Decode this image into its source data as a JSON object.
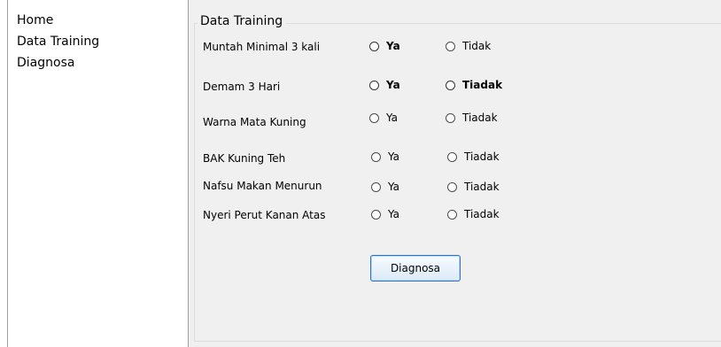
{
  "sidebar": {
    "items": [
      {
        "label": "Home"
      },
      {
        "label": "Data Training"
      },
      {
        "label": "Diagnosa"
      }
    ]
  },
  "panel": {
    "title": "Data Training",
    "questions": [
      {
        "label": "Muntah Minimal 3 kali",
        "yes": "Ya",
        "no": "Tidak"
      },
      {
        "label": "Demam 3 Hari",
        "yes": "Ya",
        "no": "Tiadak"
      },
      {
        "label": "Warna Mata Kuning",
        "yes": "Ya",
        "no": "Tiadak"
      },
      {
        "label": "BAK Kuning Teh",
        "yes": "Ya",
        "no": "Tiadak"
      },
      {
        "label": "Nafsu Makan Menurun",
        "yes": "Ya",
        "no": "Tiadak"
      },
      {
        "label": "Nyeri Perut Kanan Atas",
        "yes": "Ya",
        "no": "Tiadak"
      }
    ],
    "button_label": "Diagnosa"
  },
  "colors": {
    "panel_bg": "#f0f0f0",
    "button_border": "#2a73c8"
  }
}
